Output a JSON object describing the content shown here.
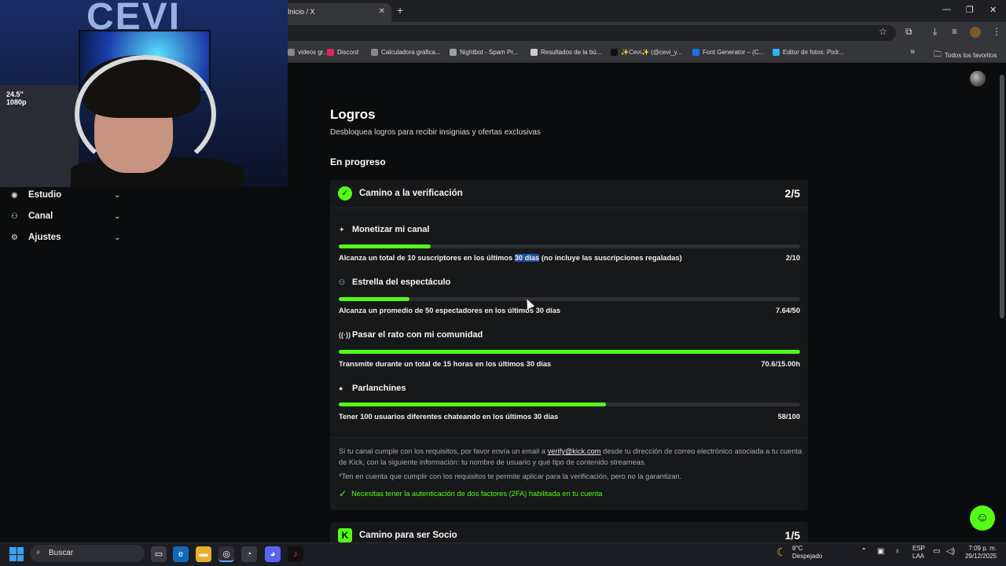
{
  "browser": {
    "tab_title": "Inicio / X",
    "bookmarks": [
      {
        "label": "videos gr...",
        "color": "#888888"
      },
      {
        "label": "Discord",
        "color": "#e0245e"
      },
      {
        "label": "Calculadora gráfica...",
        "color": "#888888"
      },
      {
        "label": "Nightbot - Spam Pr...",
        "color": "#9aa0a6"
      },
      {
        "label": "Resultados de la bú...",
        "color": "#cccccc"
      },
      {
        "label": "✨Cevi✨ (@cevi_y...",
        "color": "#111111"
      },
      {
        "label": "Font Generator – (C...",
        "color": "#1a73e8"
      },
      {
        "label": "Editor de fotos: Pixlr...",
        "color": "#2bb5f3"
      }
    ],
    "all_bookmarks": "Todos los favoritos"
  },
  "sidebar": {
    "items": [
      {
        "label": "Estudio",
        "icon": "studio-icon"
      },
      {
        "label": "Canal",
        "icon": "channel-icon"
      },
      {
        "label": "Ajustes",
        "icon": "gear-icon"
      }
    ]
  },
  "webcam": {
    "logo": "CEVI",
    "shelf_label_1": "24.5\"",
    "shelf_label_2": "1080p"
  },
  "page": {
    "title": "Logros",
    "subtitle": "Desbloquea logros para recibir insignias y ofertas exclusivas",
    "section": "En progreso"
  },
  "verification": {
    "title": "Camino a la verificación",
    "count": "2/5",
    "tasks": [
      {
        "title": "Monetizar mi canal",
        "icon": "sparkle-icon",
        "progress": 0.2,
        "desc_before": "Alcanza un total de 10 suscriptores en los últimos ",
        "desc_highlight": "30 días",
        "desc_after": " (no incluye las suscripciones regaladas)",
        "value": "2/10"
      },
      {
        "title": "Estrella del espectáculo",
        "icon": "people-icon",
        "progress": 0.153,
        "desc": "Alcanza un promedio de 50 espectadores en los últimos 30 días",
        "value": "7.64/50"
      },
      {
        "title": "Pasar el rato con mi comunidad",
        "icon": "broadcast-icon",
        "progress": 1.0,
        "desc": "Transmite durante un total de 15 horas en los últimos 30 días",
        "value": "70.6/15.00h"
      },
      {
        "title": "Parlanchines",
        "icon": "chat-icon",
        "progress": 0.58,
        "desc": "Tener 100 usuarios diferentes chateando en los últimos 30 días",
        "value": "58/100"
      }
    ],
    "info_before": "Si tu canal cumple con los requisitos, por favor envía un email a ",
    "info_email": "verify@kick.com",
    "info_after": " desde tu dirección de correo electrónico asociada a tu cuenta de Kick, con la siguiente información: tu nombre de usuario y qué tipo de contenido streameas.",
    "disclaimer": "*Ten en cuenta que cumplir con los requisitos te permite aplicar para la verificación, pero no la garantizan.",
    "twofa": "Necesitas tener la autenticación de dos factores (2FA) habilitada en tu cuenta"
  },
  "partner": {
    "title": "Camino para ser Socio",
    "count": "1/5",
    "icon_letter": "K"
  },
  "taskbar": {
    "search_placeholder": "Buscar",
    "weather_temp": "8°C",
    "weather_desc": "Despejado",
    "lang_1": "ESP",
    "lang_2": "LAA",
    "time": "7:09 p. m.",
    "date": "29/12/2025"
  },
  "colors": {
    "accent": "#53fc18",
    "card_bg": "#17181a",
    "page_bg": "#0b0c0d"
  }
}
